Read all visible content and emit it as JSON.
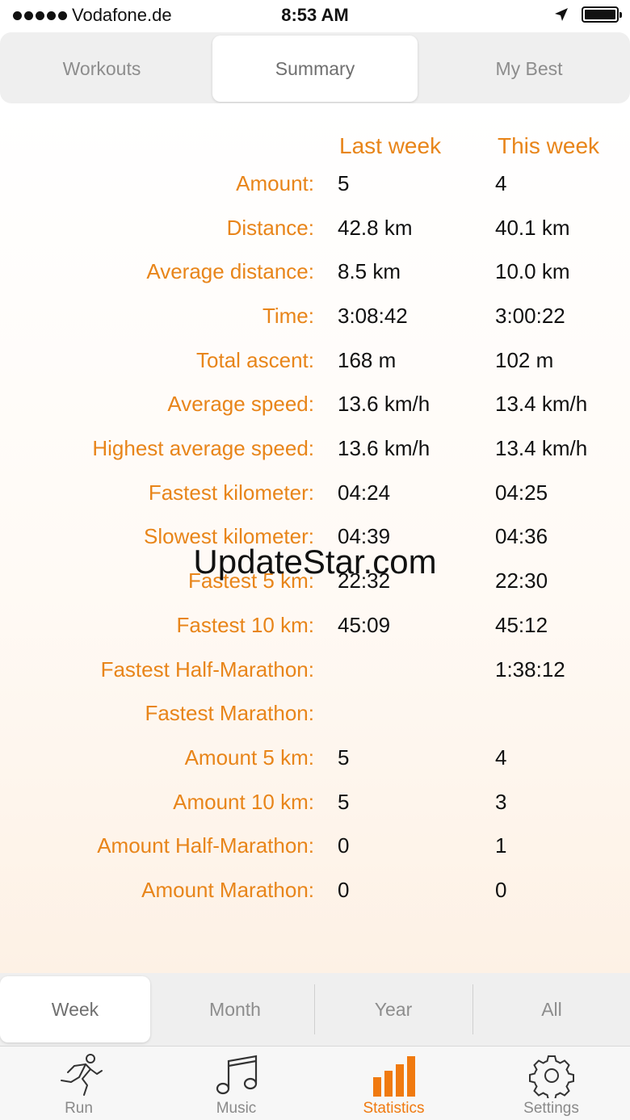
{
  "status_bar": {
    "carrier": "Vodafone.de",
    "time": "8:53 AM"
  },
  "top_tabs": {
    "items": [
      {
        "label": "Workouts",
        "active": false
      },
      {
        "label": "Summary",
        "active": true
      },
      {
        "label": "My Best",
        "active": false
      }
    ]
  },
  "summary": {
    "col_last": "Last week",
    "col_this": "This week",
    "rows": [
      {
        "label": "Amount:",
        "last": "5",
        "this": "4"
      },
      {
        "label": "Distance:",
        "last": "42.8 km",
        "this": "40.1 km"
      },
      {
        "label": "Average distance:",
        "last": "8.5 km",
        "this": "10.0 km"
      },
      {
        "label": "Time:",
        "last": "3:08:42",
        "this": "3:00:22"
      },
      {
        "label": "Total ascent:",
        "last": "168 m",
        "this": "102 m"
      },
      {
        "label": "Average speed:",
        "last": "13.6 km/h",
        "this": "13.4 km/h"
      },
      {
        "label": "Highest average speed:",
        "last": "13.6 km/h",
        "this": "13.4 km/h"
      },
      {
        "label": "Fastest kilometer:",
        "last": "04:24",
        "this": "04:25"
      },
      {
        "label": "Slowest kilometer:",
        "last": "04:39",
        "this": "04:36"
      },
      {
        "label": "Fastest 5 km:",
        "last": "22:32",
        "this": "22:30"
      },
      {
        "label": "Fastest 10 km:",
        "last": "45:09",
        "this": "45:12"
      },
      {
        "label": "Fastest Half-Marathon:",
        "last": "",
        "this": "1:38:12"
      },
      {
        "label": "Fastest Marathon:",
        "last": "",
        "this": ""
      },
      {
        "label": "Amount 5 km:",
        "last": "5",
        "this": "4"
      },
      {
        "label": "Amount 10 km:",
        "last": "5",
        "this": "3"
      },
      {
        "label": "Amount Half-Marathon:",
        "last": "0",
        "this": "1"
      },
      {
        "label": "Amount Marathon:",
        "last": "0",
        "this": "0"
      }
    ]
  },
  "watermark": "UpdateStar.com",
  "period_tabs": {
    "items": [
      {
        "label": "Week",
        "active": true
      },
      {
        "label": "Month",
        "active": false
      },
      {
        "label": "Year",
        "active": false
      },
      {
        "label": "All",
        "active": false
      }
    ]
  },
  "tab_bar": {
    "items": [
      {
        "label": "Run",
        "icon": "runner-icon",
        "active": false
      },
      {
        "label": "Music",
        "icon": "music-note-icon",
        "active": false
      },
      {
        "label": "Statistics",
        "icon": "bar-chart-icon",
        "active": true
      },
      {
        "label": "Settings",
        "icon": "gear-icon",
        "active": false
      }
    ]
  },
  "colors": {
    "accent": "#e8851a",
    "tab_active": "#f07a10",
    "inactive_text": "#8d8d8d"
  }
}
